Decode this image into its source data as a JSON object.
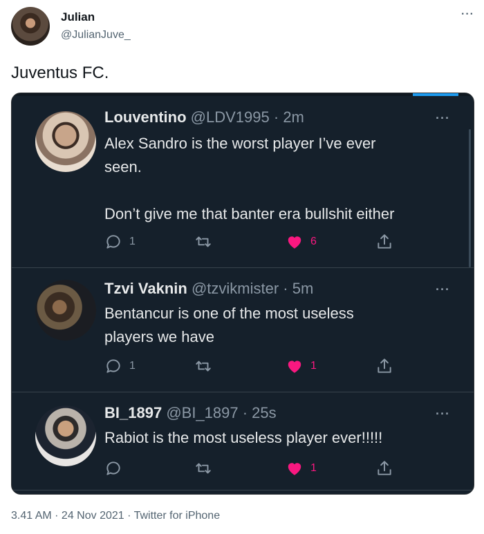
{
  "author": {
    "name": "Julian",
    "handle": "@JulianJuve_"
  },
  "tweet": {
    "text": "Juventus FC."
  },
  "quoted": [
    {
      "name": "Louventino",
      "handle": "@LDV1995",
      "time": "2m",
      "body": "Alex Sandro is the worst player I’ve ever\nseen.\n\nDon’t give me that banter era bullshit either",
      "replies": "1",
      "likes": "6"
    },
    {
      "name": "Tzvi Vaknin",
      "handle": "@tzvikmister",
      "time": "5m",
      "body": "Bentancur is one of the most useless\nplayers we have",
      "replies": "1",
      "likes": "1"
    },
    {
      "name": "BI_1897",
      "handle": "@BI_1897",
      "time": "25s",
      "body": "Rabiot is the most useless player ever!!!!!",
      "replies": "",
      "likes": "1"
    }
  ],
  "footer": {
    "time": "3.41 AM",
    "date": "24 Nov 2021",
    "source": "Twitter for iPhone"
  },
  "colors": {
    "accent": "#1d9bf0",
    "like": "#f91880",
    "dark_bg": "#15202b"
  },
  "icons": {
    "reply": "reply-icon",
    "retweet": "retweet-icon",
    "like": "heart-icon",
    "share": "share-icon",
    "more": "more-icon"
  }
}
